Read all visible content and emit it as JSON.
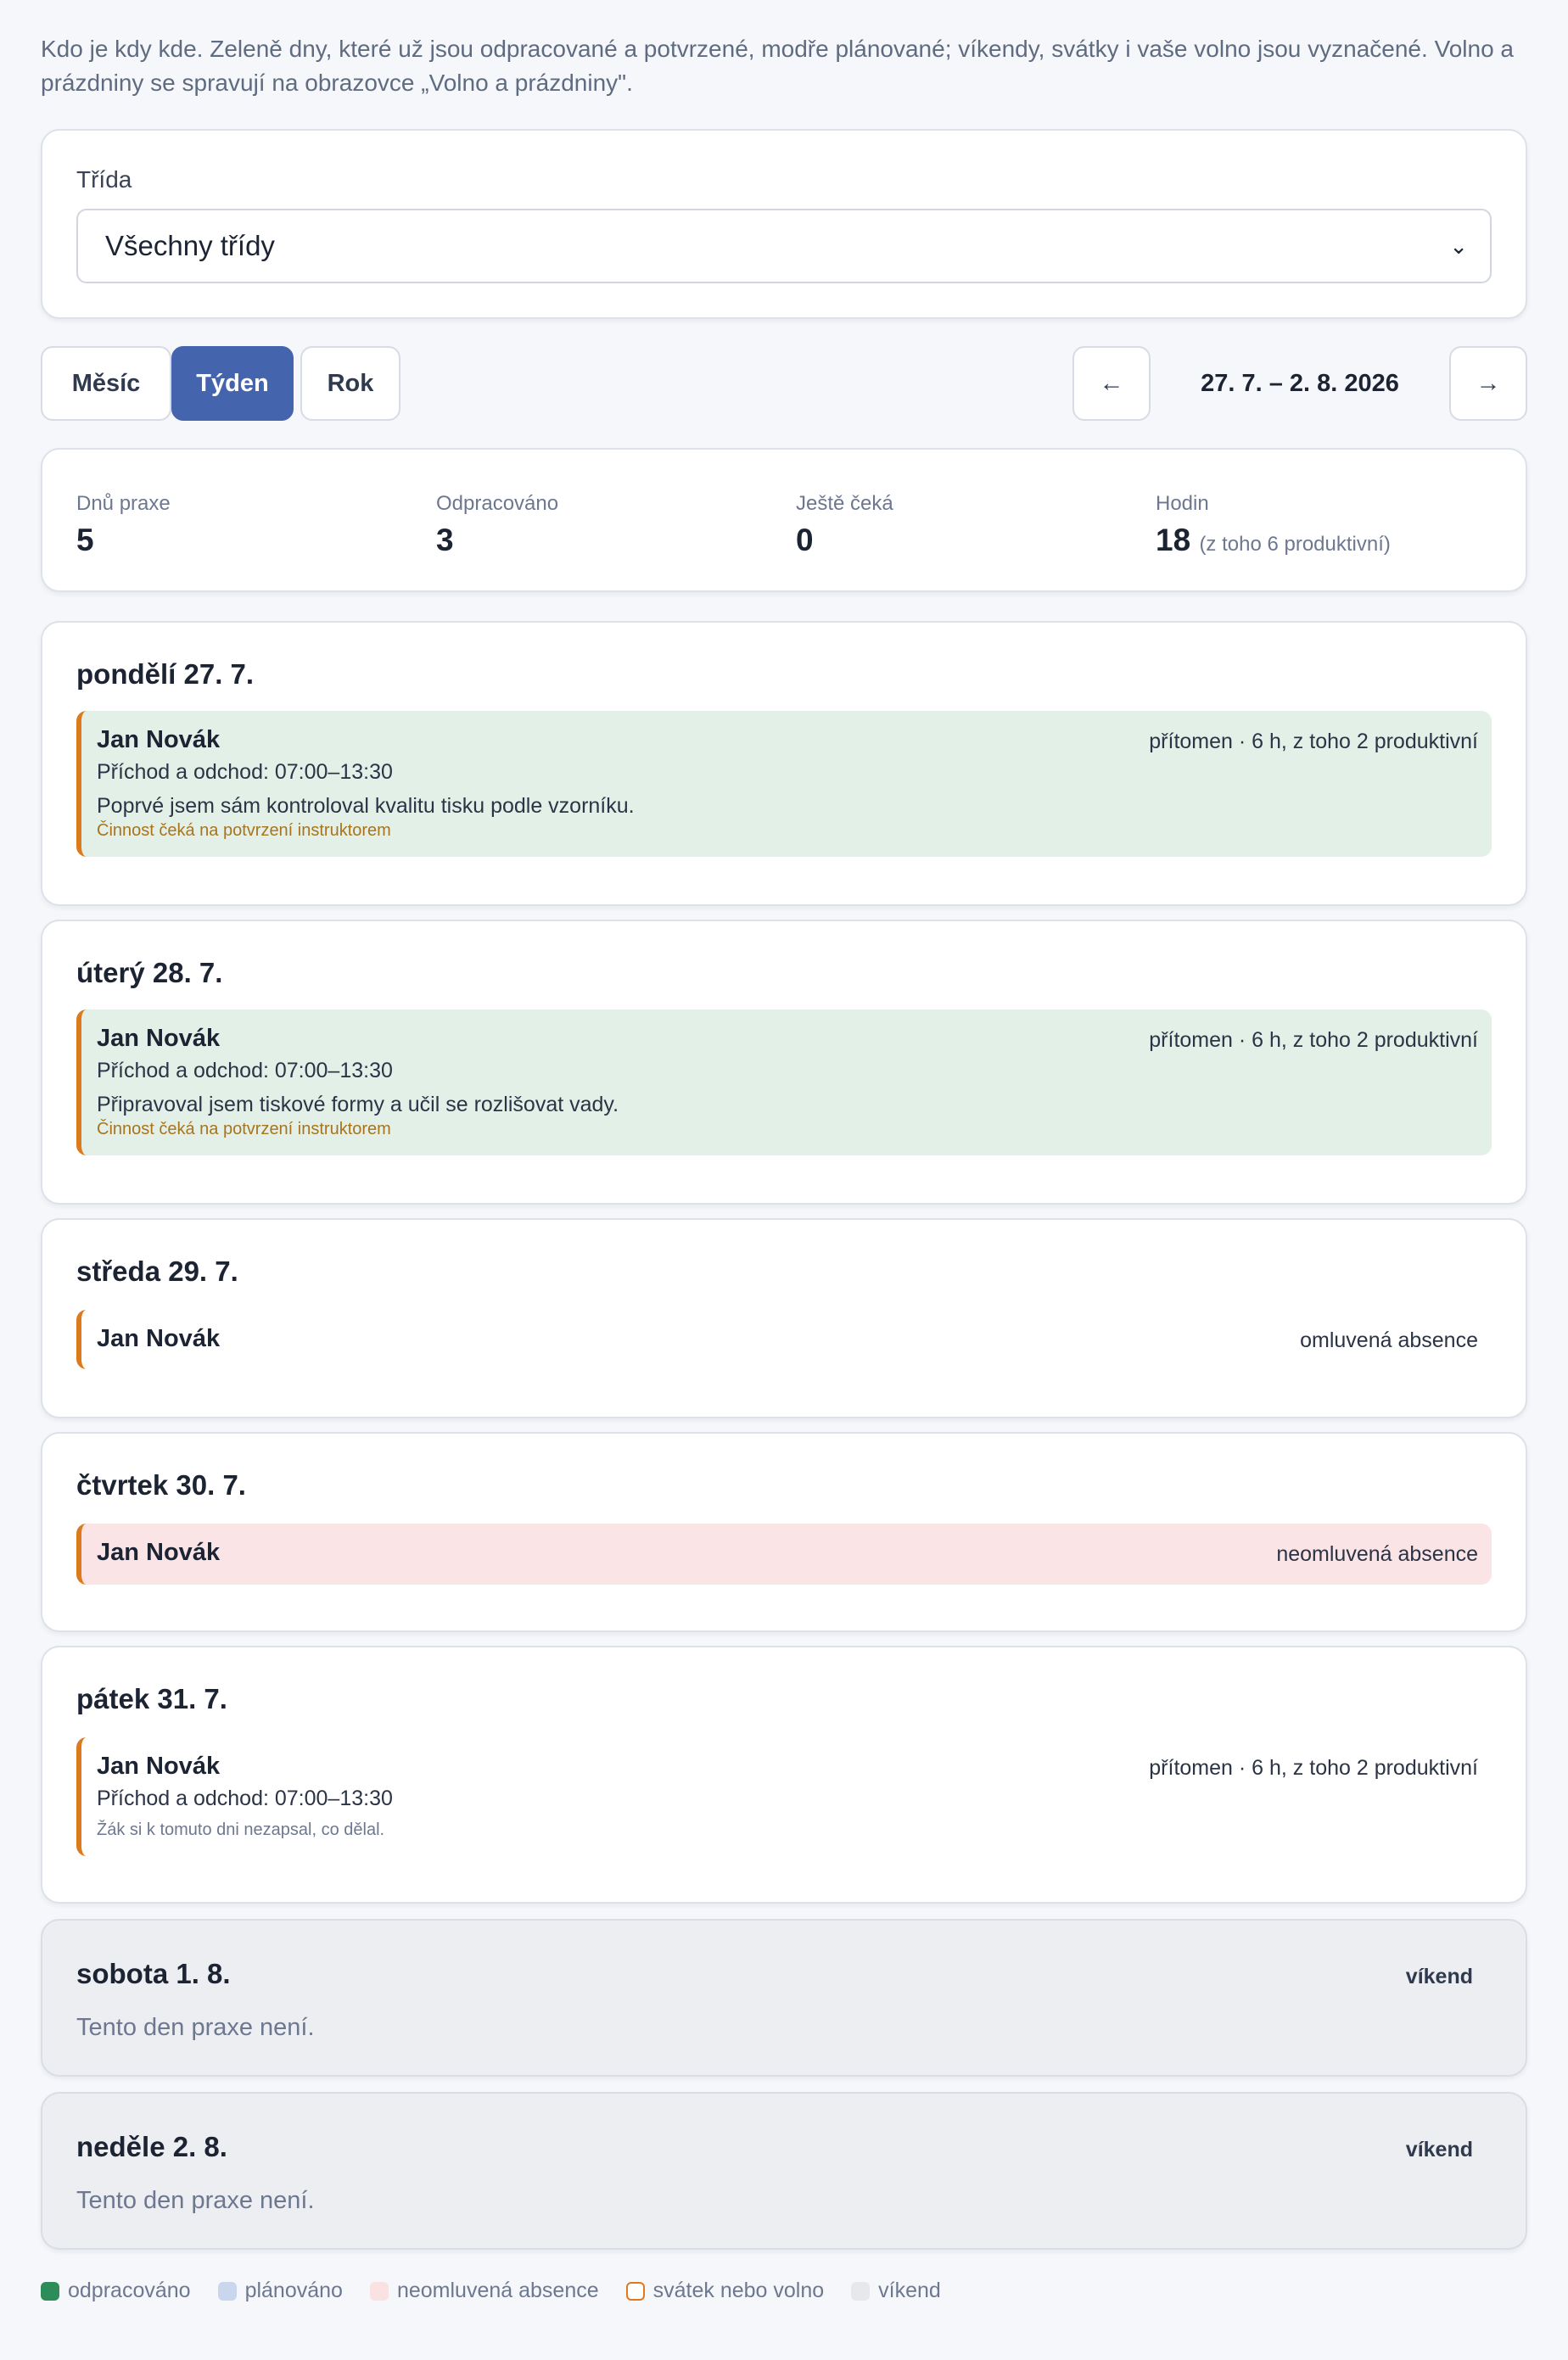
{
  "intro": "Kdo je kdy kde. Zeleně dny, které už jsou odpracované a potvrzené, modře plánované; víkendy, svátky i vaše volno jsou vyznačené. Volno a prázdniny se spravují na obrazovce „Volno a prázdniny\".",
  "filter": {
    "label": "Třída",
    "selected": "Všechny třídy",
    "caret_icon": "chevron-down-icon"
  },
  "view_tabs": [
    {
      "label": "Měsíc",
      "active": false
    },
    {
      "label": "Týden",
      "active": true
    },
    {
      "label": "Rok",
      "active": false
    }
  ],
  "range": {
    "prev": "←",
    "label": "27. 7. – 2. 8. 2026",
    "next": "→"
  },
  "stats": [
    {
      "label": "Dnů praxe",
      "value": "5",
      "sub": ""
    },
    {
      "label": "Odpracováno",
      "value": "3",
      "sub": ""
    },
    {
      "label": "Ještě čeká",
      "value": "0",
      "sub": ""
    },
    {
      "label": "Hodin",
      "value": "18",
      "sub": "(z toho 6 produktivní)"
    }
  ],
  "days": [
    {
      "title": "pondělí 27. 7.",
      "entry": {
        "name": "Jan Novák",
        "status": "přítomen · 6 h, z toho 2 produktivní",
        "time": "Příchod a odchod: 07:00–13:30",
        "note": "Poprvé jsem sám kontroloval kvalitu tisku podle vzorníku.",
        "pending": "Činnost čeká na potvrzení instruktorem"
      }
    },
    {
      "title": "úterý 28. 7.",
      "entry": {
        "name": "Jan Novák",
        "status": "přítomen · 6 h, z toho 2 produktivní",
        "time": "Příchod a odchod: 07:00–13:30",
        "note": "Připravoval jsem tiskové formy a učil se rozlišovat vady.",
        "pending": "Činnost čeká na potvrzení instruktorem"
      }
    },
    {
      "title": "středa 29. 7.",
      "entry": {
        "name": "Jan Novák",
        "status": "omluvená absence"
      }
    },
    {
      "title": "čtvrtek 30. 7.",
      "entry": {
        "name": "Jan Novák",
        "status": "neomluvená absence"
      }
    },
    {
      "title": "pátek 31. 7.",
      "entry": {
        "name": "Jan Novák",
        "status": "přítomen · 6 h, z toho 2 produktivní",
        "time": "Příchod a odchod: 07:00–13:30",
        "missing": "Žák si k tomuto dni nezapsal, co dělal."
      }
    },
    {
      "title": "sobota 1. 8.",
      "tag": "víkend",
      "text": "Tento den praxe není."
    },
    {
      "title": "neděle 2. 8.",
      "tag": "víkend",
      "text": "Tento den praxe není."
    }
  ],
  "legend": [
    {
      "label": "odpracováno",
      "color": "#2e8c5a"
    },
    {
      "label": "plánováno",
      "color": "#c9d6ee"
    },
    {
      "label": "neomluvená absence",
      "color": "#fae1e2"
    },
    {
      "label": "svátek nebo volno",
      "color": "#dd7a1b"
    },
    {
      "label": "víkend",
      "color": "#e6e8ec"
    }
  ],
  "colors": {
    "accent": "#4464ae",
    "worked_bg": "#e2f0e7",
    "absence_bg": "#fae4e5",
    "entry_border": "#dd7a1b",
    "pending_text": "#a8741d"
  }
}
